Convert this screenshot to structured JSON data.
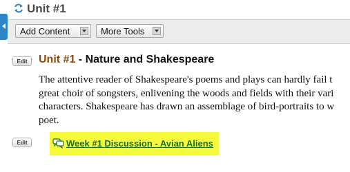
{
  "header": {
    "title": "Unit #1",
    "refresh_icon": "refresh-icon"
  },
  "toolbar": {
    "add_content_label": "Add Content",
    "more_tools_label": "More Tools"
  },
  "item": {
    "edit_label": "Edit",
    "unit_label": "Unit #1",
    "title_rest": " - Nature and Shakespeare",
    "description_lines": [
      "The attentive reader of Shakespeare's poems and plays can hardly fail t",
      "great choir of songsters, enlivening the woods and fields with their vari",
      "characters. Shakespeare has drawn an assemblage of bird-portraits to w",
      "poet."
    ]
  },
  "discussion": {
    "edit_label": "Edit",
    "link_text": "Week #1 Discussion - Avian Aliens",
    "icon": "discussion-bubbles-icon",
    "highlight_color": "#f6fa3c",
    "link_color": "#1a6f1a"
  }
}
